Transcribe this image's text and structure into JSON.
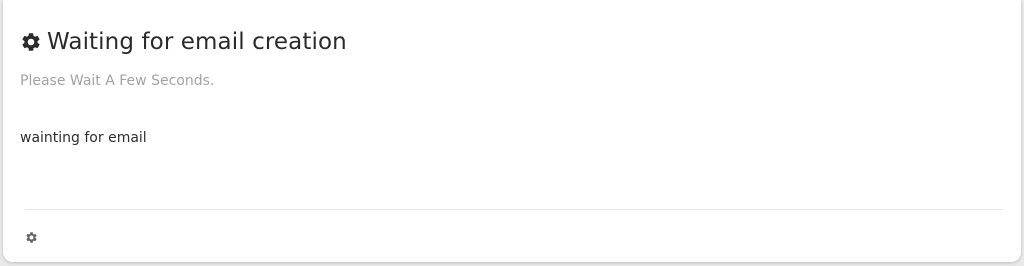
{
  "card": {
    "title": "Waiting for email creation",
    "subtitle": "Please Wait A Few Seconds.",
    "message": "wainting for email",
    "header_icon": "gear-icon",
    "footer_icon": "gear-icon"
  },
  "colors": {
    "title": "#2b2b2b",
    "subtitle": "#a3a3a3",
    "icon": "#2b2b2b",
    "footer_icon": "#666666",
    "background": "#ffffff"
  }
}
